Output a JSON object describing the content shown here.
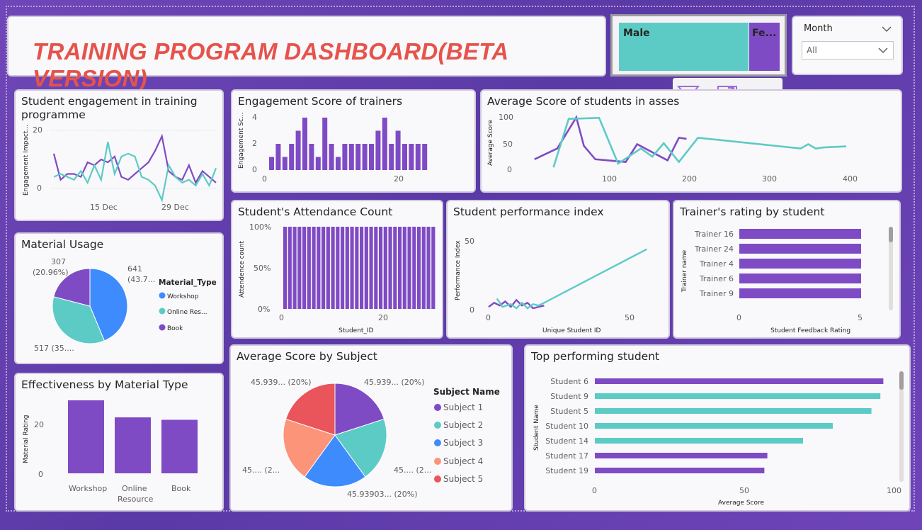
{
  "header": {
    "title": "TRAINING PROGRAM DASHBOARD(BETA VERSION)"
  },
  "gender": {
    "male": "Male",
    "female": "Fe..."
  },
  "slicer": {
    "label": "Month",
    "value": "All"
  },
  "colors": {
    "purple": "#7f4bc4",
    "teal": "#5ccbc6",
    "blue": "#3d8bfd",
    "salmon": "#fb9478",
    "red": "#e9555a",
    "title": "#e5534b"
  },
  "visual_header_icons": [
    "filter-icon",
    "focus-mode-icon",
    "more-options-icon"
  ],
  "engagement": {
    "title": "Student engagement in training programme",
    "title_l1": "Student engagement in training",
    "title_l2": "programme",
    "ylabel": "Engagement Impact...",
    "yticks": [
      "20",
      "0"
    ],
    "xticks": [
      "15 Dec",
      "29 Dec"
    ]
  },
  "trainer_score": {
    "title": "Engagement Score of trainers",
    "ylabel": "Engagement Sc...",
    "yticks": [
      "4",
      "2",
      "0"
    ],
    "xticks": [
      "0",
      "20"
    ]
  },
  "avg_score_assess": {
    "title": "Average Score of students in assessment",
    "title_visible": "Average Score of students in asses",
    "ylabel": "Average Score",
    "yticks": [
      "100",
      "50",
      "0"
    ],
    "xticks": [
      "100",
      "200",
      "300",
      "400"
    ]
  },
  "material_usage": {
    "title": "Material Usage",
    "legend_title": "Material_Type",
    "labels": {
      "workshop": "641",
      "workshop_pct": "(43.7...",
      "online": "517 (35....",
      "book": "307",
      "book_pct": "(20.96%)"
    },
    "legend": [
      "Workshop",
      "Online Res...",
      "Book"
    ]
  },
  "attendance": {
    "title": "Student's Attendance Count",
    "ylabel": "Attendence count",
    "xlabel": "Student_ID",
    "yticks": [
      "100%",
      "50%",
      "0%"
    ],
    "xticks": [
      "0",
      "20"
    ]
  },
  "perf_index": {
    "title": "Student performance index",
    "ylabel": "Performance Index",
    "xlabel": "Unique Student ID",
    "yticks": [
      "50",
      "0"
    ],
    "xticks": [
      "0",
      "50"
    ]
  },
  "trainer_rating": {
    "title": "Trainer's rating by student",
    "ylabel": "Trainer name",
    "xlabel": "Student Feedback Rating",
    "xticks": [
      "0",
      "5"
    ]
  },
  "effectiveness": {
    "title": "Effectiveness by Material Type",
    "ylabel": "Material Rating",
    "yticks": [
      "20",
      "0"
    ],
    "xlabels": [
      "Workshop",
      "Online",
      "Resource",
      "Book"
    ]
  },
  "avg_subject": {
    "title": "Average Score by Subject",
    "legend_title": "Subject Name",
    "legend": [
      "Subject 1",
      "Subject 2",
      "Subject 3",
      "Subject 4",
      "Subject 5"
    ],
    "labels": [
      "45.939... (20%)",
      "45.939... (20%)",
      "45.... (2...",
      "45.93903... (20%)",
      "45.... (2..."
    ]
  },
  "top_student": {
    "title": "Top performing student",
    "ylabel": "Student Name",
    "xlabel": "Average Score",
    "xticks": [
      "0",
      "50",
      "100"
    ]
  },
  "chart_data": [
    {
      "type": "line",
      "title": "Student engagement in training programme",
      "ylabel": "Engagement Impact...",
      "ylim": [
        0,
        20
      ],
      "series": [
        {
          "name": "purple",
          "color": "#7f4bc4",
          "values": [
            12,
            3,
            5,
            5,
            4,
            9,
            8,
            10,
            9,
            11,
            4,
            3,
            5,
            7,
            9,
            13,
            18,
            6,
            4,
            3,
            8,
            2,
            6,
            4,
            2
          ]
        },
        {
          "name": "teal",
          "color": "#5ccbc6",
          "values": [
            4,
            5,
            4,
            3,
            6,
            2,
            8,
            3,
            16,
            5,
            11,
            12,
            11,
            4,
            3,
            1,
            -4,
            8,
            4,
            2,
            3,
            1,
            5,
            1,
            7
          ]
        }
      ]
    },
    {
      "type": "bar",
      "title": "Engagement Score of trainers",
      "ylabel": "Engagement Sc...",
      "ylim": [
        0,
        4
      ],
      "values": [
        1,
        2,
        1,
        2,
        3,
        4,
        2,
        1,
        4,
        2,
        1,
        2,
        2,
        2,
        2,
        2,
        3,
        4,
        2,
        3,
        2,
        2,
        2,
        2
      ]
    },
    {
      "type": "line",
      "title": "Average Score of students in assessment",
      "ylabel": "Average Score",
      "ylim": [
        0,
        100
      ],
      "xlim": [
        0,
        430
      ],
      "series": [
        {
          "name": "purple",
          "color": "#7f4bc4",
          "points": [
            [
              10,
              20
            ],
            [
              40,
              40
            ],
            [
              65,
              98
            ],
            [
              75,
              45
            ],
            [
              90,
              20
            ],
            [
              130,
              15
            ],
            [
              145,
              48
            ],
            [
              185,
              18
            ],
            [
              200,
              60
            ],
            [
              210,
              58
            ]
          ]
        },
        {
          "name": "teal",
          "color": "#5ccbc6",
          "points": [
            [
              35,
              5
            ],
            [
              55,
              95
            ],
            [
              95,
              97
            ],
            [
              120,
              12
            ],
            [
              150,
              40
            ],
            [
              165,
              25
            ],
            [
              180,
              50
            ],
            [
              200,
              15
            ],
            [
              225,
              60
            ],
            [
              360,
              40
            ],
            [
              370,
              48
            ],
            [
              380,
              40
            ],
            [
              390,
              42
            ],
            [
              420,
              44
            ]
          ]
        }
      ]
    },
    {
      "type": "pie",
      "title": "Material Usage",
      "slices": [
        {
          "label": "Workshop",
          "value": 641,
          "pct": 43.7,
          "color": "#3d8bfd"
        },
        {
          "label": "Online Resource",
          "value": 517,
          "pct": 35.3,
          "color": "#5ccbc6"
        },
        {
          "label": "Book",
          "value": 307,
          "pct": 20.96,
          "color": "#7f4bc4"
        }
      ]
    },
    {
      "type": "bar",
      "title": "Student's Attendance Count",
      "ylabel": "Attendence count",
      "xlabel": "Student_ID",
      "ylim": [
        0,
        100
      ],
      "values": [
        100,
        100,
        100,
        100,
        100,
        100,
        100,
        100,
        100,
        100,
        100,
        100,
        100,
        100,
        100,
        100,
        100,
        100,
        100,
        100,
        100,
        100,
        100,
        100,
        100,
        100,
        100,
        100,
        100,
        100,
        100,
        100
      ]
    },
    {
      "type": "line",
      "title": "Student performance index",
      "ylabel": "Performance Index",
      "xlabel": "Unique Student ID",
      "ylim": [
        0,
        60
      ],
      "xlim": [
        0,
        70
      ],
      "series": [
        {
          "name": "purple",
          "color": "#7f4bc4",
          "points": [
            [
              0,
              2
            ],
            [
              2,
              5
            ],
            [
              4,
              3
            ],
            [
              6,
              6
            ],
            [
              8,
              2
            ],
            [
              10,
              7
            ],
            [
              12,
              3
            ],
            [
              14,
              5
            ],
            [
              16,
              1
            ],
            [
              18,
              2
            ],
            [
              20,
              3
            ]
          ]
        },
        {
          "name": "teal",
          "color": "#5ccbc6",
          "points": [
            [
              3,
              8
            ],
            [
              5,
              2
            ],
            [
              8,
              4
            ],
            [
              10,
              1
            ],
            [
              12,
              5
            ],
            [
              14,
              1
            ],
            [
              16,
              4
            ],
            [
              18,
              3
            ],
            [
              20,
              5
            ],
            [
              57,
              44
            ]
          ]
        }
      ]
    },
    {
      "type": "bar",
      "orientation": "horizontal",
      "title": "Trainer's rating by student",
      "xlim": [
        0,
        5
      ],
      "categories": [
        "Trainer 16",
        "Trainer 24",
        "Trainer 4",
        "Trainer 6",
        "Trainer 9"
      ],
      "values": [
        5,
        5,
        5,
        5,
        5
      ]
    },
    {
      "type": "bar",
      "title": "Effectiveness by Material Type",
      "ylabel": "Material Rating",
      "ylim": [
        0,
        30
      ],
      "categories": [
        "Workshop",
        "Online Resource",
        "Book"
      ],
      "values": [
        30,
        23,
        22
      ]
    },
    {
      "type": "pie",
      "title": "Average Score by Subject",
      "slices": [
        {
          "label": "Subject 1",
          "value": 45.939,
          "pct": 20,
          "color": "#7f4bc4"
        },
        {
          "label": "Subject 2",
          "value": 45.939,
          "pct": 20,
          "color": "#5ccbc6"
        },
        {
          "label": "Subject 3",
          "value": 45.939,
          "pct": 20,
          "color": "#3d8bfd"
        },
        {
          "label": "Subject 4",
          "value": 45.939,
          "pct": 20,
          "color": "#fb9478"
        },
        {
          "label": "Subject 5",
          "value": 45.939,
          "pct": 20,
          "color": "#e9555a"
        }
      ]
    },
    {
      "type": "bar",
      "orientation": "horizontal",
      "title": "Top performing student",
      "xlabel": "Average Score",
      "xlim": [
        0,
        100
      ],
      "categories": [
        "Student 6",
        "Student 9",
        "Student 5",
        "Student 10",
        "Student 14",
        "Student 17",
        "Student 19"
      ],
      "values": [
        97,
        96,
        93,
        80,
        70,
        58,
        57
      ],
      "colors": [
        "#7f4bc4",
        "#5ccbc6",
        "#5ccbc6",
        "#5ccbc6",
        "#5ccbc6",
        "#7f4bc4",
        "#7f4bc4"
      ]
    }
  ]
}
